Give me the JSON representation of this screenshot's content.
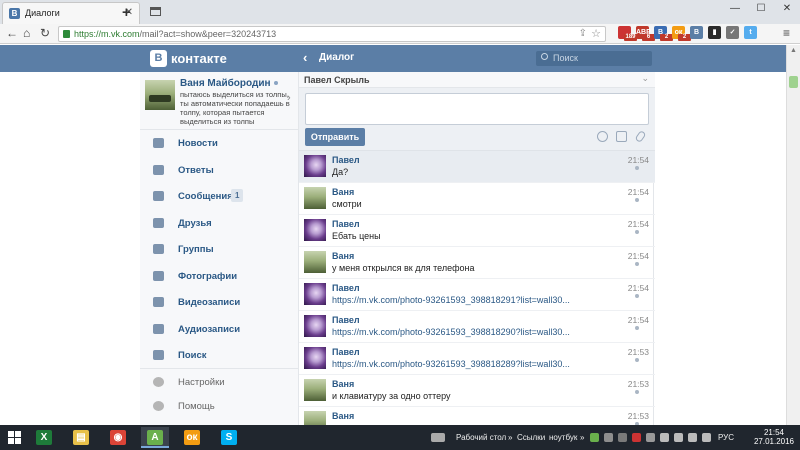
{
  "browser": {
    "tab_title": "Диалоги",
    "url_base": "https://m.vk.com",
    "url_rest": "/mail?act=show&peer=320243713",
    "extensions": [
      {
        "name": "chart-ext-icon",
        "color": "#c33",
        "badge": "189"
      },
      {
        "name": "adblock-icon",
        "color": "#c0392b",
        "label": "ABP",
        "badge": "6"
      },
      {
        "name": "vk-ext-icon",
        "color": "#3b6db3",
        "label": "В",
        "badge": "2"
      },
      {
        "name": "odnoklassniki-ext-icon",
        "color": "#f39c12",
        "label": "ок",
        "badge": "2"
      },
      {
        "name": "vk-music-icon",
        "color": "#5b7ea6",
        "label": "В"
      },
      {
        "name": "bookmark-ext-icon",
        "color": "#2a2a2a",
        "label": "▮"
      },
      {
        "name": "check-ext-icon",
        "color": "#777",
        "label": "✓"
      },
      {
        "name": "twitter-ext-icon",
        "color": "#55acee",
        "label": "t"
      }
    ]
  },
  "vk": {
    "logo_text": "контакте",
    "logo_letter": "В",
    "header_title": "Диалог",
    "search_placeholder": "Поиск"
  },
  "profile": {
    "name": "Ваня Майбородин",
    "status": "пытаюсь выделиться из толпы, ты автоматически попадаешь в толпу, которая пытается выделиться из толпы"
  },
  "menu": [
    {
      "label": "Новости",
      "icon": "news-icon"
    },
    {
      "label": "Ответы",
      "icon": "replies-icon"
    },
    {
      "label": "Сообщения",
      "icon": "messages-icon",
      "count": "1"
    },
    {
      "label": "Друзья",
      "icon": "friends-icon"
    },
    {
      "label": "Группы",
      "icon": "groups-icon"
    },
    {
      "label": "Фотографии",
      "icon": "photos-icon"
    },
    {
      "label": "Видеозаписи",
      "icon": "videos-icon"
    },
    {
      "label": "Аудиозаписи",
      "icon": "audio-icon"
    },
    {
      "label": "Поиск",
      "icon": "search-icon"
    }
  ],
  "menu_secondary": [
    {
      "label": "Настройки",
      "icon": "settings-icon"
    },
    {
      "label": "Помощь",
      "icon": "help-icon"
    }
  ],
  "dialog": {
    "peer_name": "Павел Скрыль",
    "send_label": "Отправить"
  },
  "messages": [
    {
      "author": "Павел",
      "avatar": "wolf",
      "text": "Да?",
      "time": "21:54",
      "link": false
    },
    {
      "author": "Ваня",
      "avatar": "tank",
      "text": "смотри",
      "time": "21:54",
      "link": false
    },
    {
      "author": "Павел",
      "avatar": "wolf",
      "text": "Ебать цены",
      "time": "21:54",
      "link": false
    },
    {
      "author": "Ваня",
      "avatar": "tank",
      "text": "у меня открылся вк для телефона",
      "time": "21:54",
      "link": false
    },
    {
      "author": "Павел",
      "avatar": "wolf",
      "text": "https://m.vk.com/photo-93261593_398818291?list=wall30...",
      "time": "21:54",
      "link": true
    },
    {
      "author": "Павел",
      "avatar": "wolf",
      "text": "https://m.vk.com/photo-93261593_398818290?list=wall30...",
      "time": "21:54",
      "link": true
    },
    {
      "author": "Павел",
      "avatar": "wolf",
      "text": "https://m.vk.com/photo-93261593_398818289?list=wall30...",
      "time": "21:53",
      "link": true
    },
    {
      "author": "Ваня",
      "avatar": "tank",
      "text": "и клавиатуру за одно оттеру",
      "time": "21:53",
      "link": false
    },
    {
      "author": "Ваня",
      "avatar": "tank",
      "text": "",
      "time": "21:53",
      "link": false
    }
  ],
  "taskbar": {
    "apps": [
      {
        "name": "excel-app-icon",
        "color": "#1e7b3a",
        "label": "X"
      },
      {
        "name": "file-explorer-icon",
        "color": "#e8c049",
        "label": "▤"
      },
      {
        "name": "chrome-app-icon",
        "color": "#db4437",
        "label": "◉"
      },
      {
        "name": "aimp-app-icon",
        "color": "#6ab04c",
        "label": "A"
      },
      {
        "name": "odnoklassniki-app-icon",
        "color": "#f39c12",
        "label": "ок"
      },
      {
        "name": "skype-app-icon",
        "color": "#00aff0",
        "label": "S"
      }
    ],
    "desktop_label": "Рабочий стол",
    "links_label": "Ссылки",
    "device_label": "ноутбук",
    "lang": "РУС",
    "time": "21:54",
    "date": "27.01.2016"
  }
}
